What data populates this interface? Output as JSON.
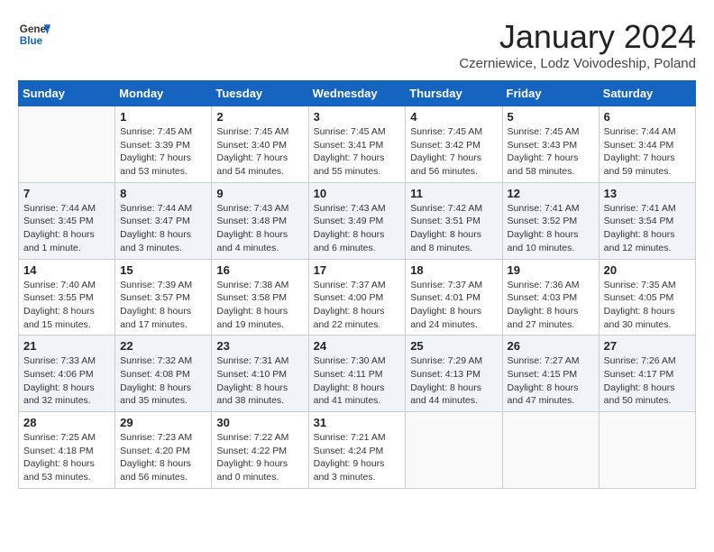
{
  "header": {
    "logo_general": "General",
    "logo_blue": "Blue",
    "month_title": "January 2024",
    "location": "Czerniewice, Lodz Voivodeship, Poland"
  },
  "days_of_week": [
    "Sunday",
    "Monday",
    "Tuesday",
    "Wednesday",
    "Thursday",
    "Friday",
    "Saturday"
  ],
  "weeks": [
    {
      "shaded": false,
      "days": [
        {
          "number": "",
          "sunrise": "",
          "sunset": "",
          "daylight": "",
          "empty": true
        },
        {
          "number": "1",
          "sunrise": "Sunrise: 7:45 AM",
          "sunset": "Sunset: 3:39 PM",
          "daylight": "Daylight: 7 hours and 53 minutes."
        },
        {
          "number": "2",
          "sunrise": "Sunrise: 7:45 AM",
          "sunset": "Sunset: 3:40 PM",
          "daylight": "Daylight: 7 hours and 54 minutes."
        },
        {
          "number": "3",
          "sunrise": "Sunrise: 7:45 AM",
          "sunset": "Sunset: 3:41 PM",
          "daylight": "Daylight: 7 hours and 55 minutes."
        },
        {
          "number": "4",
          "sunrise": "Sunrise: 7:45 AM",
          "sunset": "Sunset: 3:42 PM",
          "daylight": "Daylight: 7 hours and 56 minutes."
        },
        {
          "number": "5",
          "sunrise": "Sunrise: 7:45 AM",
          "sunset": "Sunset: 3:43 PM",
          "daylight": "Daylight: 7 hours and 58 minutes."
        },
        {
          "number": "6",
          "sunrise": "Sunrise: 7:44 AM",
          "sunset": "Sunset: 3:44 PM",
          "daylight": "Daylight: 7 hours and 59 minutes."
        }
      ]
    },
    {
      "shaded": true,
      "days": [
        {
          "number": "7",
          "sunrise": "Sunrise: 7:44 AM",
          "sunset": "Sunset: 3:45 PM",
          "daylight": "Daylight: 8 hours and 1 minute."
        },
        {
          "number": "8",
          "sunrise": "Sunrise: 7:44 AM",
          "sunset": "Sunset: 3:47 PM",
          "daylight": "Daylight: 8 hours and 3 minutes."
        },
        {
          "number": "9",
          "sunrise": "Sunrise: 7:43 AM",
          "sunset": "Sunset: 3:48 PM",
          "daylight": "Daylight: 8 hours and 4 minutes."
        },
        {
          "number": "10",
          "sunrise": "Sunrise: 7:43 AM",
          "sunset": "Sunset: 3:49 PM",
          "daylight": "Daylight: 8 hours and 6 minutes."
        },
        {
          "number": "11",
          "sunrise": "Sunrise: 7:42 AM",
          "sunset": "Sunset: 3:51 PM",
          "daylight": "Daylight: 8 hours and 8 minutes."
        },
        {
          "number": "12",
          "sunrise": "Sunrise: 7:41 AM",
          "sunset": "Sunset: 3:52 PM",
          "daylight": "Daylight: 8 hours and 10 minutes."
        },
        {
          "number": "13",
          "sunrise": "Sunrise: 7:41 AM",
          "sunset": "Sunset: 3:54 PM",
          "daylight": "Daylight: 8 hours and 12 minutes."
        }
      ]
    },
    {
      "shaded": false,
      "days": [
        {
          "number": "14",
          "sunrise": "Sunrise: 7:40 AM",
          "sunset": "Sunset: 3:55 PM",
          "daylight": "Daylight: 8 hours and 15 minutes."
        },
        {
          "number": "15",
          "sunrise": "Sunrise: 7:39 AM",
          "sunset": "Sunset: 3:57 PM",
          "daylight": "Daylight: 8 hours and 17 minutes."
        },
        {
          "number": "16",
          "sunrise": "Sunrise: 7:38 AM",
          "sunset": "Sunset: 3:58 PM",
          "daylight": "Daylight: 8 hours and 19 minutes."
        },
        {
          "number": "17",
          "sunrise": "Sunrise: 7:37 AM",
          "sunset": "Sunset: 4:00 PM",
          "daylight": "Daylight: 8 hours and 22 minutes."
        },
        {
          "number": "18",
          "sunrise": "Sunrise: 7:37 AM",
          "sunset": "Sunset: 4:01 PM",
          "daylight": "Daylight: 8 hours and 24 minutes."
        },
        {
          "number": "19",
          "sunrise": "Sunrise: 7:36 AM",
          "sunset": "Sunset: 4:03 PM",
          "daylight": "Daylight: 8 hours and 27 minutes."
        },
        {
          "number": "20",
          "sunrise": "Sunrise: 7:35 AM",
          "sunset": "Sunset: 4:05 PM",
          "daylight": "Daylight: 8 hours and 30 minutes."
        }
      ]
    },
    {
      "shaded": true,
      "days": [
        {
          "number": "21",
          "sunrise": "Sunrise: 7:33 AM",
          "sunset": "Sunset: 4:06 PM",
          "daylight": "Daylight: 8 hours and 32 minutes."
        },
        {
          "number": "22",
          "sunrise": "Sunrise: 7:32 AM",
          "sunset": "Sunset: 4:08 PM",
          "daylight": "Daylight: 8 hours and 35 minutes."
        },
        {
          "number": "23",
          "sunrise": "Sunrise: 7:31 AM",
          "sunset": "Sunset: 4:10 PM",
          "daylight": "Daylight: 8 hours and 38 minutes."
        },
        {
          "number": "24",
          "sunrise": "Sunrise: 7:30 AM",
          "sunset": "Sunset: 4:11 PM",
          "daylight": "Daylight: 8 hours and 41 minutes."
        },
        {
          "number": "25",
          "sunrise": "Sunrise: 7:29 AM",
          "sunset": "Sunset: 4:13 PM",
          "daylight": "Daylight: 8 hours and 44 minutes."
        },
        {
          "number": "26",
          "sunrise": "Sunrise: 7:27 AM",
          "sunset": "Sunset: 4:15 PM",
          "daylight": "Daylight: 8 hours and 47 minutes."
        },
        {
          "number": "27",
          "sunrise": "Sunrise: 7:26 AM",
          "sunset": "Sunset: 4:17 PM",
          "daylight": "Daylight: 8 hours and 50 minutes."
        }
      ]
    },
    {
      "shaded": false,
      "days": [
        {
          "number": "28",
          "sunrise": "Sunrise: 7:25 AM",
          "sunset": "Sunset: 4:18 PM",
          "daylight": "Daylight: 8 hours and 53 minutes."
        },
        {
          "number": "29",
          "sunrise": "Sunrise: 7:23 AM",
          "sunset": "Sunset: 4:20 PM",
          "daylight": "Daylight: 8 hours and 56 minutes."
        },
        {
          "number": "30",
          "sunrise": "Sunrise: 7:22 AM",
          "sunset": "Sunset: 4:22 PM",
          "daylight": "Daylight: 9 hours and 0 minutes."
        },
        {
          "number": "31",
          "sunrise": "Sunrise: 7:21 AM",
          "sunset": "Sunset: 4:24 PM",
          "daylight": "Daylight: 9 hours and 3 minutes."
        },
        {
          "number": "",
          "sunrise": "",
          "sunset": "",
          "daylight": "",
          "empty": true
        },
        {
          "number": "",
          "sunrise": "",
          "sunset": "",
          "daylight": "",
          "empty": true
        },
        {
          "number": "",
          "sunrise": "",
          "sunset": "",
          "daylight": "",
          "empty": true
        }
      ]
    }
  ]
}
